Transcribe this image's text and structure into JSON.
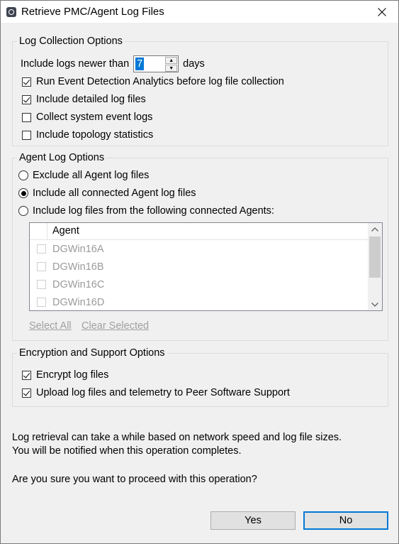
{
  "window": {
    "title": "Retrieve PMC/Agent Log Files"
  },
  "log_collection": {
    "title": "Log Collection Options",
    "newer_than_label": "Include logs newer than",
    "newer_than_value": "7",
    "days_label": "days",
    "options": [
      {
        "label": "Run Event Detection Analytics before log file collection",
        "checked": true
      },
      {
        "label": "Include detailed log files",
        "checked": true
      },
      {
        "label": "Collect system event logs",
        "checked": false
      },
      {
        "label": "Include topology statistics",
        "checked": false
      }
    ]
  },
  "agent_log": {
    "title": "Agent Log Options",
    "radios": [
      {
        "label": "Exclude all Agent log files",
        "selected": false
      },
      {
        "label": "Include all connected Agent log files",
        "selected": true
      },
      {
        "label": "Include log files from the following connected Agents:",
        "selected": false
      }
    ],
    "list": {
      "column_header": "Agent",
      "rows": [
        "DGWin16A",
        "DGWin16B",
        "DGWin16C",
        "DGWin16D"
      ]
    },
    "select_all": "Select All",
    "clear_selected": "Clear Selected"
  },
  "encryption": {
    "title": "Encryption and Support Options",
    "options": [
      {
        "label": "Encrypt log files",
        "checked": true
      },
      {
        "label": "Upload log files and telemetry to Peer Software Support",
        "checked": true
      }
    ]
  },
  "message": {
    "line1": "Log retrieval can take a while based on network speed and log file sizes.",
    "line2": "You will be notified when this operation completes.",
    "question": "Are you sure you want to proceed with this operation?"
  },
  "buttons": {
    "yes": "Yes",
    "no": "No"
  },
  "colors": {
    "accent": "#0078d7",
    "disabled_text": "#a0a0a0"
  }
}
